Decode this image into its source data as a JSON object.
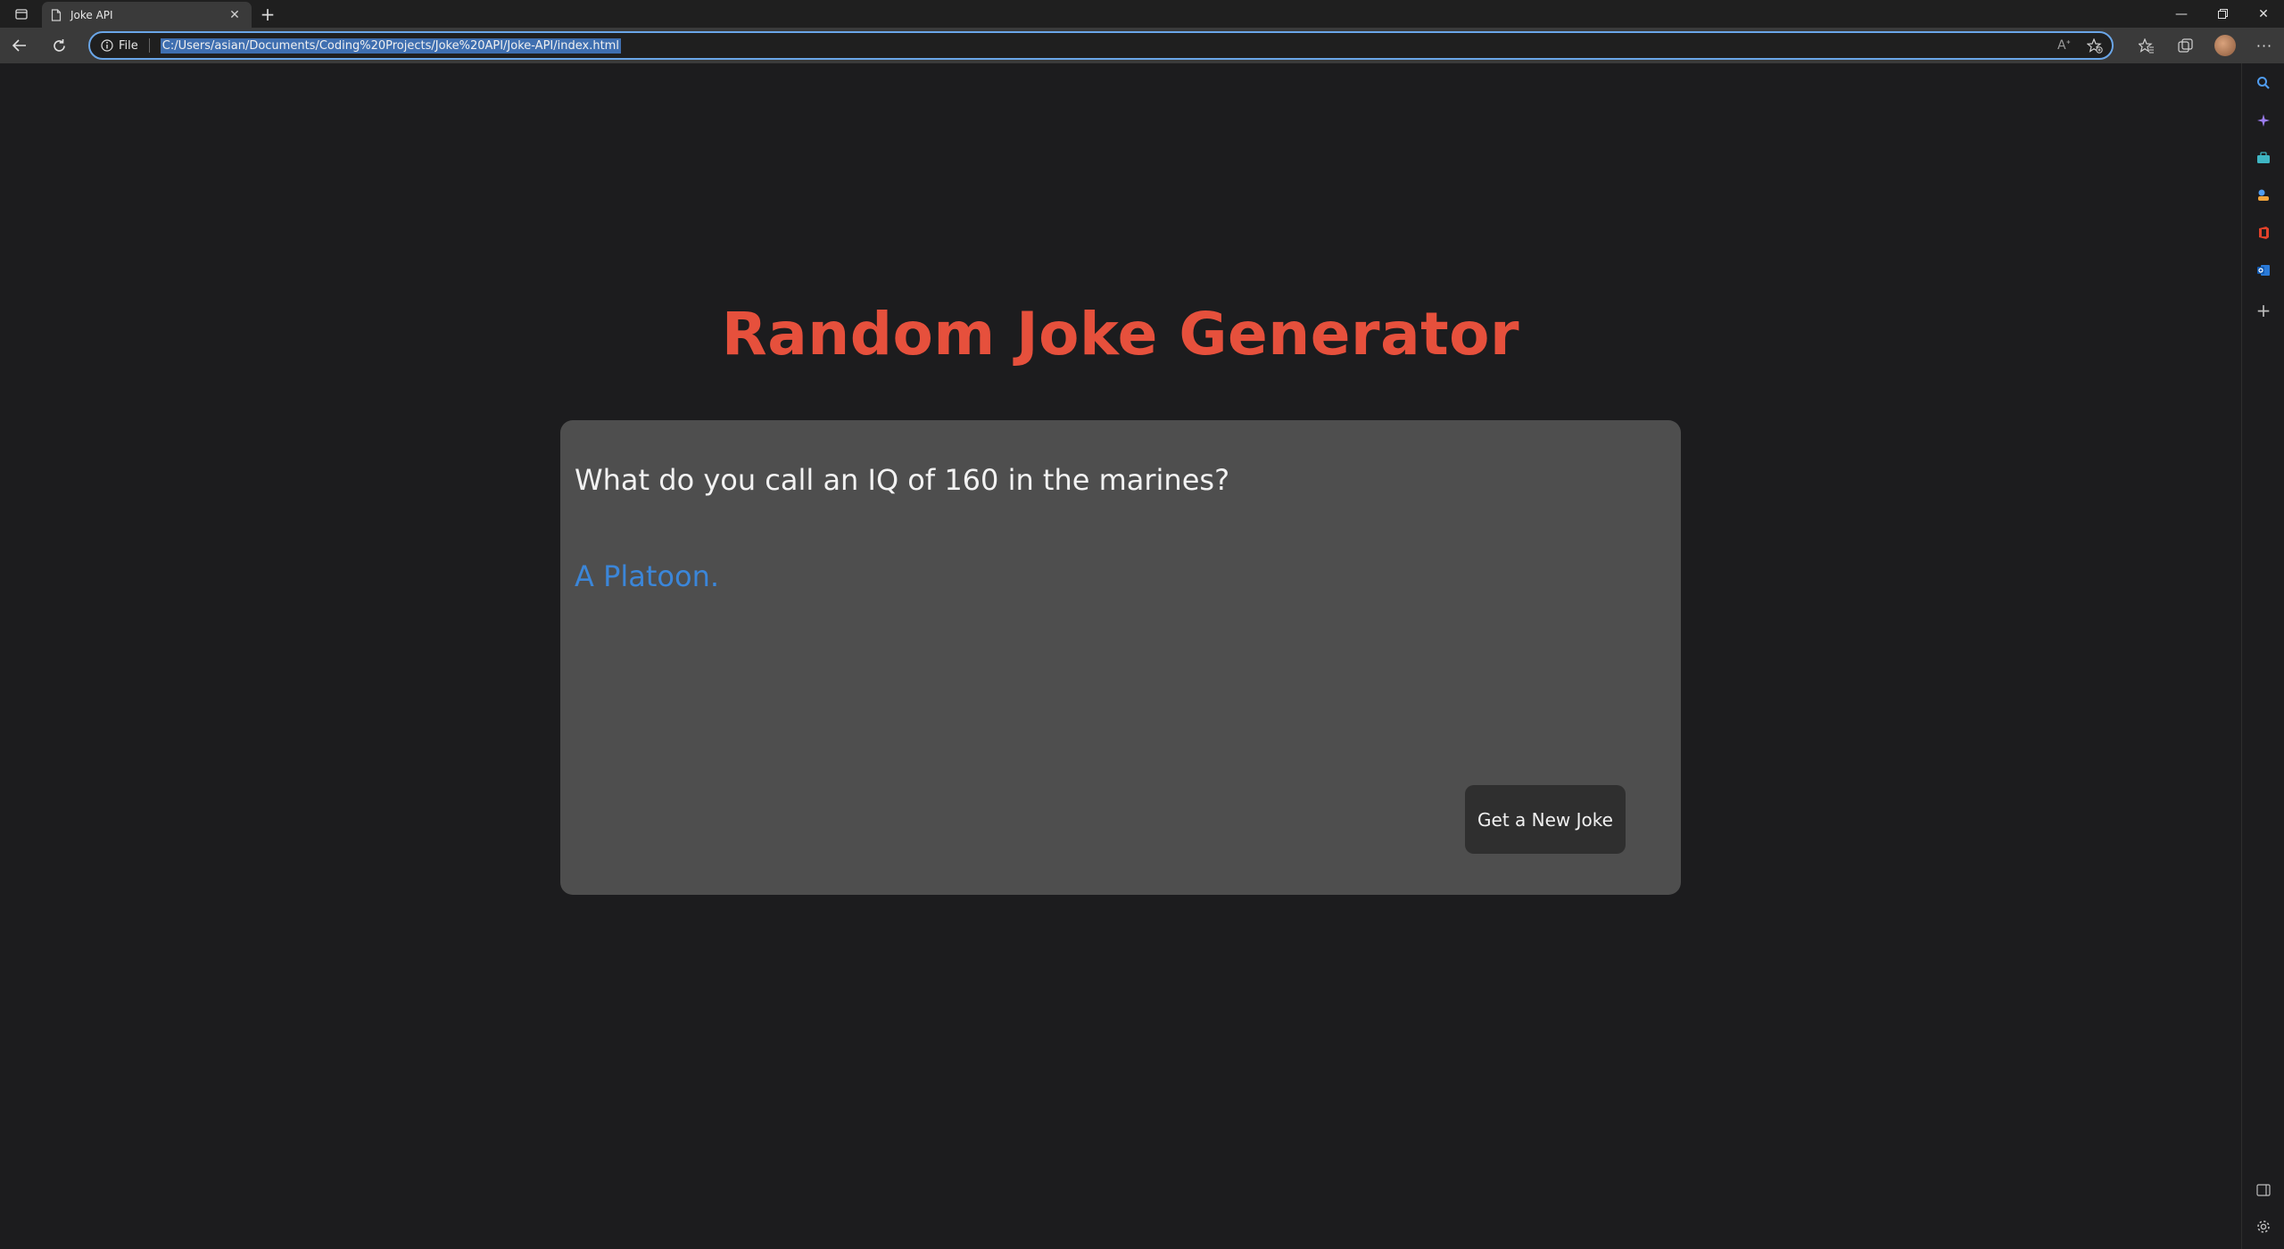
{
  "browser": {
    "tab": {
      "title": "Joke API"
    },
    "address": {
      "scheme_label": "File",
      "url": "C:/Users/asian/Documents/Coding%20Projects/Joke%20API/Joke-API/index.html"
    },
    "colors": {
      "accent": "#6aa6e8",
      "url_highlight": "#3f6fb0"
    }
  },
  "page": {
    "heading": "Random Joke Generator",
    "joke": {
      "setup": "What do you call an IQ of 160 in the marines?",
      "punchline": "A Platoon."
    },
    "button_label": "Get a New Joke",
    "colors": {
      "heading": "#e6503c",
      "punchline": "#3b86d9",
      "card": "#4e4e4e",
      "background": "#1c1c1e"
    }
  }
}
